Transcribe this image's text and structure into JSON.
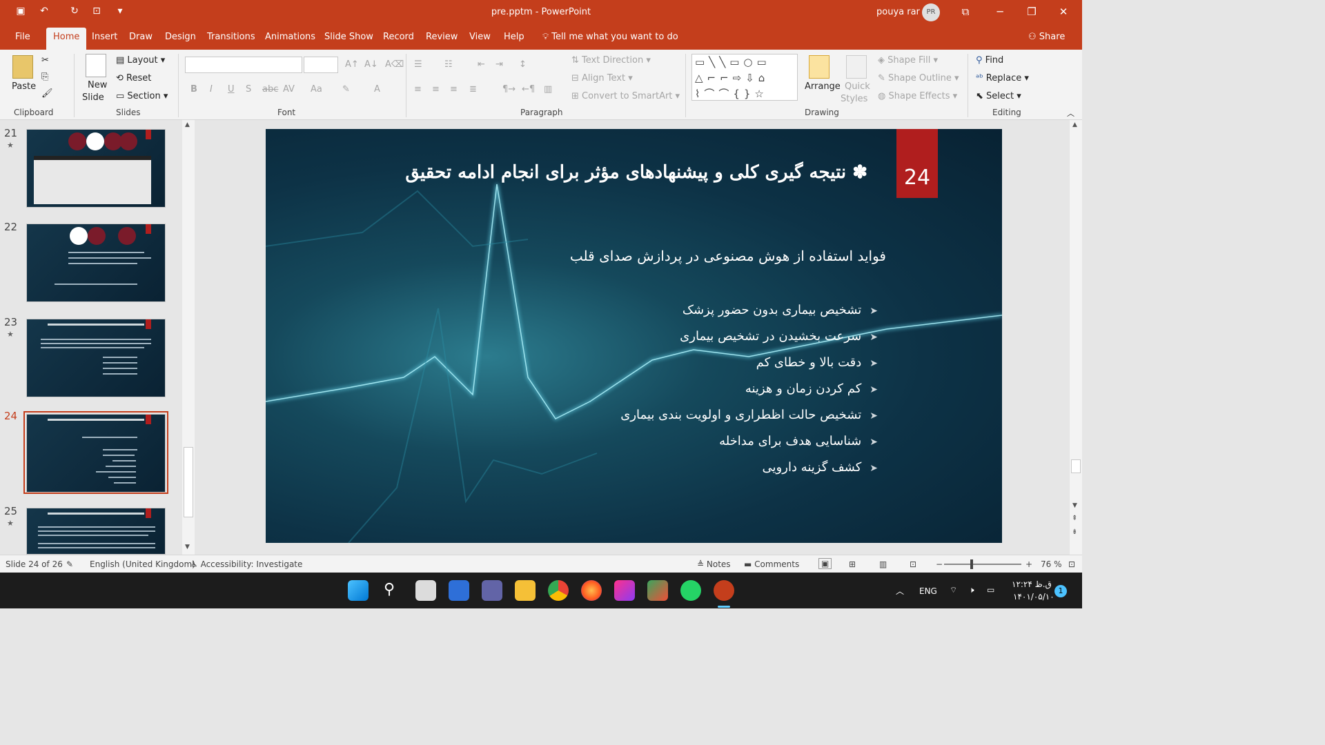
{
  "window": {
    "title": "pre.pptm  -  PowerPoint",
    "user_name": "pouya rar",
    "avatar_initials": "PR"
  },
  "tabs": [
    "File",
    "Home",
    "Insert",
    "Draw",
    "Design",
    "Transitions",
    "Animations",
    "Slide Show",
    "Record",
    "Review",
    "View",
    "Help"
  ],
  "tell_me": "Tell me what you want to do",
  "share_label": "Share",
  "ribbon": {
    "clipboard": {
      "paste": "Paste",
      "label": "Clipboard"
    },
    "slides": {
      "new_slide_1": "New",
      "new_slide_2": "Slide",
      "layout": "Layout",
      "reset": "Reset",
      "section": "Section",
      "label": "Slides"
    },
    "font": {
      "label": "Font"
    },
    "paragraph": {
      "text_direction": "Text Direction",
      "align_text": "Align Text",
      "convert_smartart": "Convert to SmartArt",
      "label": "Paragraph"
    },
    "drawing": {
      "arrange": "Arrange",
      "quick_styles_1": "Quick",
      "quick_styles_2": "Styles",
      "shape_fill": "Shape Fill",
      "shape_outline": "Shape Outline",
      "shape_effects": "Shape Effects",
      "label": "Drawing"
    },
    "editing": {
      "find": "Find",
      "replace": "Replace",
      "select": "Select",
      "label": "Editing"
    }
  },
  "thumbnails": [
    {
      "num": "21",
      "starred": true
    },
    {
      "num": "22",
      "starred": false
    },
    {
      "num": "23",
      "starred": true
    },
    {
      "num": "24",
      "starred": false,
      "selected": true
    },
    {
      "num": "25",
      "starred": true
    }
  ],
  "slide": {
    "number": "24",
    "title": "✽ نتیجه گیری کلی و پیشنهادهای مؤثر برای انجام ادامه تحقیق",
    "subtitle": "فواید استفاده از هوش مصنوعی در پردازش صدای قلب",
    "bullets": [
      "تشخیص بیماری بدون حضور پزشک",
      "سرعت بخشیدن در تشخیص بیماری",
      "دقت بالا و خطای کم",
      "کم کردن زمان و هزینه",
      "تشخیص حالت اظطراری و اولویت بندی بیماری",
      "شناسایی هدف برای مداخله",
      "کشف گزینه دارویی"
    ]
  },
  "status": {
    "slide_info": "Slide 24 of 26",
    "language": "English (United Kingdom)",
    "accessibility": "Accessibility: Investigate",
    "notes": "Notes",
    "comments": "Comments",
    "zoom": "76 %"
  },
  "taskbar": {
    "lang": "ENG",
    "time": "۱۲:۲۴ ق.ظ",
    "date": "۱۴۰۱/۰۵/۱۰",
    "notif_count": "1"
  }
}
